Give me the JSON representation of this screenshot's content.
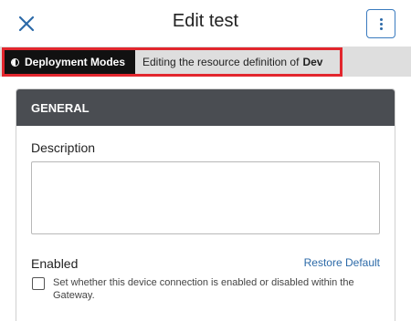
{
  "header": {
    "title": "Edit test",
    "close_icon": "close-icon",
    "menu_icon": "kebab-menu-icon"
  },
  "mode_bar": {
    "badge_label": "Deployment Modes",
    "editing_text": "Editing the resource definition of",
    "mode_name": "Dev",
    "highlight_color": "#e2262d"
  },
  "section": {
    "title": "GENERAL",
    "description_label": "Description",
    "description_value": "",
    "enabled_label": "Enabled",
    "restore_default_label": "Restore Default",
    "enabled_checked": false,
    "enabled_help": "Set whether this device connection is enabled or disabled within the Gateway."
  }
}
